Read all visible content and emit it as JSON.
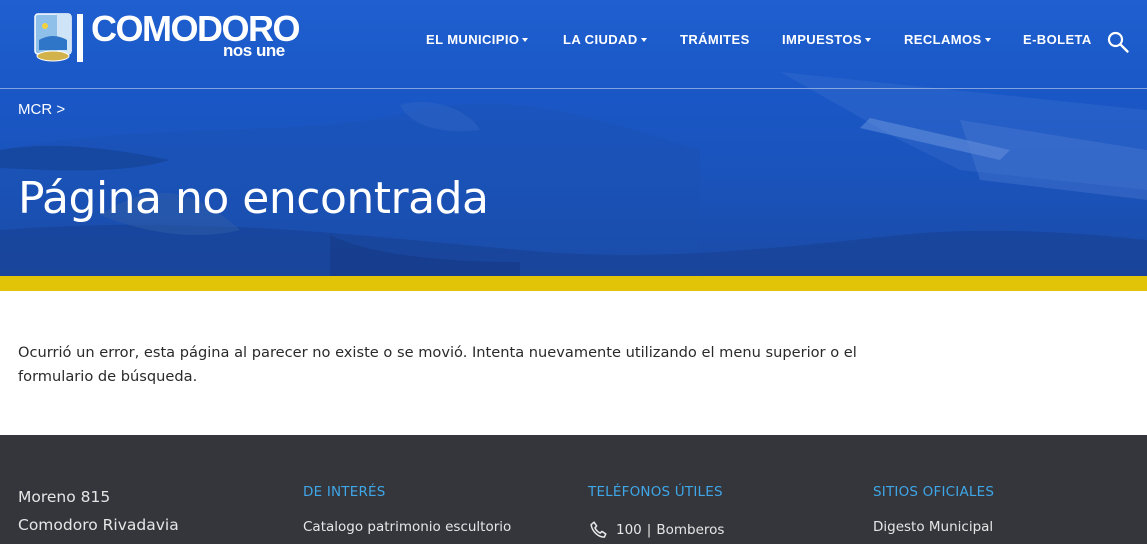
{
  "header": {
    "logo_title": "COMODORO",
    "logo_subtitle": "nos une",
    "nav": [
      {
        "label": "EL MUNICIPIO",
        "dropdown": true
      },
      {
        "label": "LA CIUDAD",
        "dropdown": true
      },
      {
        "label": "TRÁMITES",
        "dropdown": false
      },
      {
        "label": "IMPUESTOS",
        "dropdown": true
      },
      {
        "label": "RECLAMOS",
        "dropdown": true
      },
      {
        "label": "E-BOLETA",
        "dropdown": false
      }
    ],
    "search_icon": "search-icon"
  },
  "breadcrumb": "MCR >",
  "page_title": "Página no encontrada",
  "error_message": "Ocurrió un error, esta página al parecer no existe o se movió. Intenta nuevamente utilizando el menu superior o el formulario de búsqueda.",
  "footer": {
    "address_lines": [
      "Moreno 815",
      "Comodoro Rivadavia"
    ],
    "de_interes": {
      "title": "DE INTERÉS",
      "first_link": "Catalogo patrimonio escultorio"
    },
    "telefonos": {
      "title": "TELÉFONOS ÚTILES",
      "first_number": "100",
      "first_label": "Bomberos",
      "separator": "|"
    },
    "sitios": {
      "title": "SITIOS OFICIALES",
      "first_link": "Digesto Municipal"
    }
  },
  "colors": {
    "hero_blue": "#1a57c6",
    "accent_yellow": "#e1c307",
    "footer_bg": "#34363b",
    "footer_heading": "#3fa6e8"
  }
}
